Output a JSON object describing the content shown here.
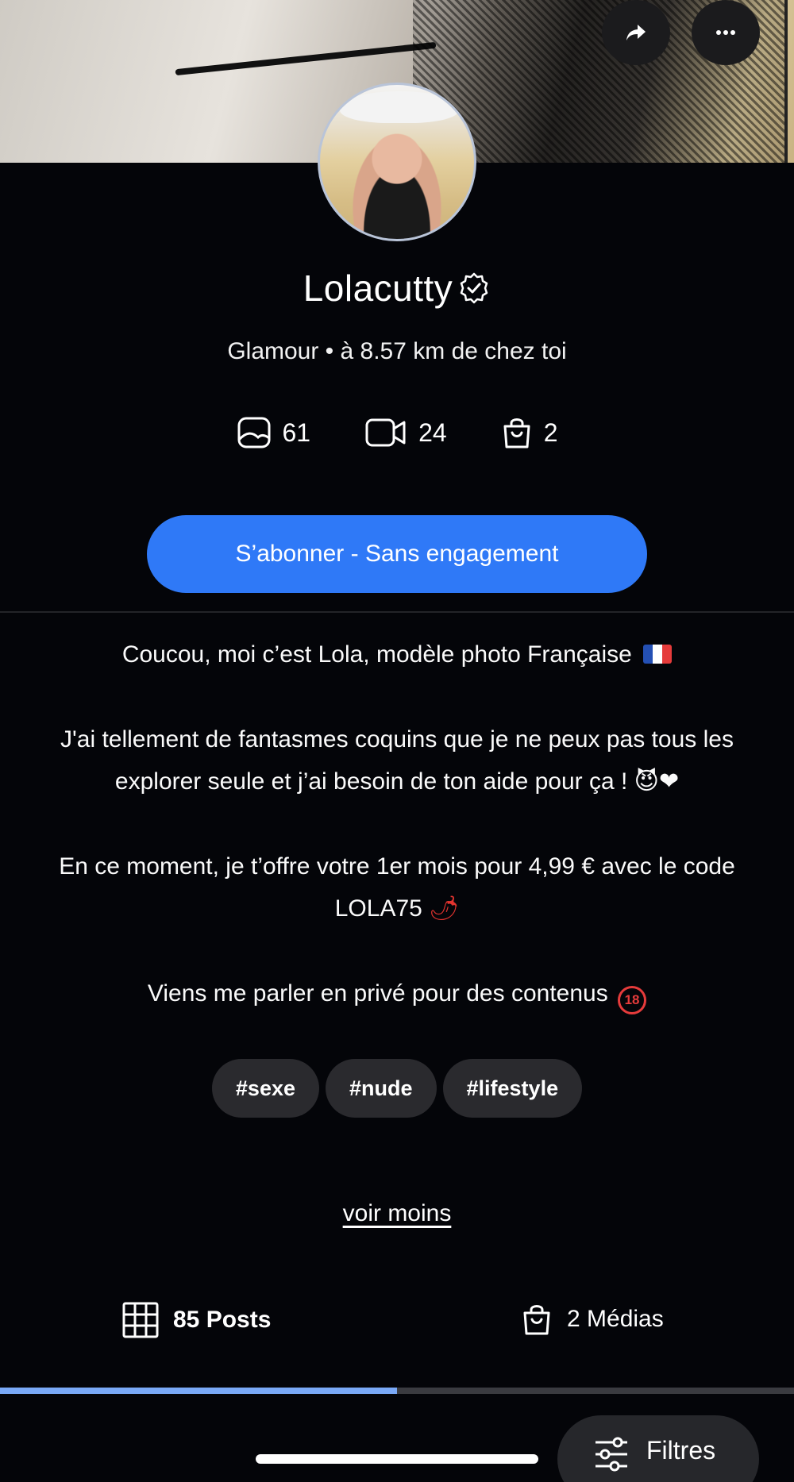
{
  "cover": {
    "image": "profile-cover-photo"
  },
  "header_actions": {
    "share_icon": "share-arrow-icon",
    "more_icon": "more-dots-icon"
  },
  "profile": {
    "name": "Lolacutty",
    "verified_icon": "verified-badge-icon",
    "subtitle": "Glamour • à 8.57 km de chez toi"
  },
  "stats": [
    {
      "icon": "photo-icon",
      "count": "61"
    },
    {
      "icon": "video-icon",
      "count": "24"
    },
    {
      "icon": "bag-icon",
      "count": "2"
    }
  ],
  "subscribe_label": "S’abonner - Sans engagement",
  "bio": {
    "line1": "Coucou, moi c’est Lola, modèle photo Française",
    "line1_emoji": "french-flag",
    "line2": "J'ai tellement de fantasmes coquins que je ne peux pas tous les explorer seule et j’ai besoin de ton aide pour ça !",
    "line2_emoji": "😈❤",
    "line3": "En ce moment, je t’offre votre 1er mois pour 4,99 € avec le code LOLA75",
    "line3_emoji": "🌶",
    "line4": "Viens me parler en privé pour des contenus",
    "line4_badge": "18"
  },
  "tags": [
    "#sexe",
    "#nude",
    "#lifestyle"
  ],
  "see_less": "voir moins",
  "tabs": {
    "posts": "85 Posts",
    "medias": "2 Médias",
    "active": "posts"
  },
  "progress": {
    "fraction": 0.5,
    "color": "#7aa9f7"
  },
  "filters_label": "Filtres",
  "colors": {
    "accent": "#2f79f7",
    "background": "#040509",
    "chip": "#2a2a2e"
  }
}
